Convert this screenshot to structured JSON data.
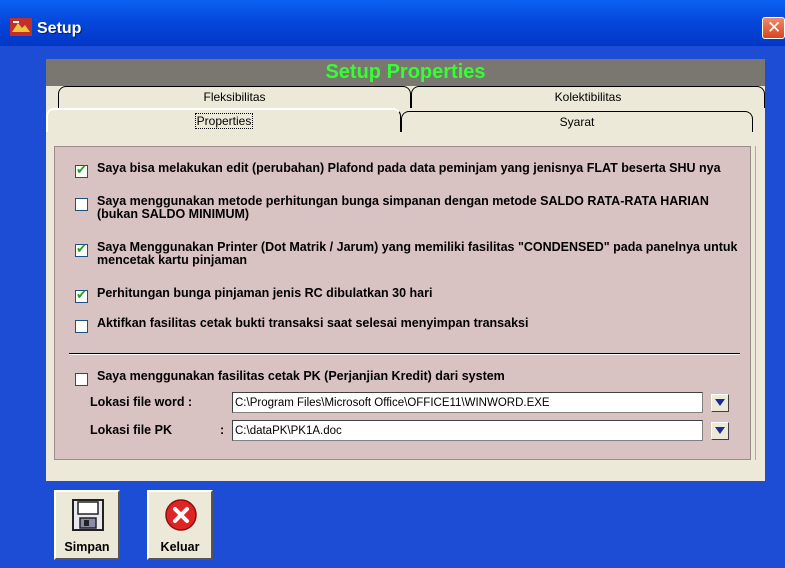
{
  "window": {
    "title": "Setup",
    "close_icon": "close-icon",
    "app_icon": "setup-app-icon"
  },
  "header": {
    "title": "Setup Properties"
  },
  "tabs": [
    {
      "label": "Fleksibilitas"
    },
    {
      "label": "Kolektibilitas"
    },
    {
      "label": "Properties",
      "active": true
    },
    {
      "label": "Syarat"
    }
  ],
  "options": [
    {
      "checked": true,
      "text": "Saya bisa melakukan edit (perubahan) Plafond pada data peminjam yang jenisnya FLAT beserta SHU nya"
    },
    {
      "checked": false,
      "text": "Saya menggunakan metode perhitungan bunga simpanan dengan metode SALDO RATA-RATA HARIAN (bukan SALDO MINIMUM)"
    },
    {
      "checked": true,
      "text": "Saya Menggunakan Printer (Dot Matrik / Jarum) yang memiliki fasilitas \"CONDENSED\" pada panelnya untuk mencetak kartu pinjaman"
    },
    {
      "checked": true,
      "text": "Perhitungan bunga pinjaman jenis RC dibulatkan 30 hari"
    },
    {
      "checked": false,
      "text": "Aktifkan fasilitas cetak bukti transaksi saat selesai menyimpan transaksi"
    },
    {
      "checked": false,
      "text": "Saya menggunakan  fasilitas cetak PK (Perjanjian Kredit) dari system"
    }
  ],
  "files": {
    "word_label": "Lokasi file word :",
    "word_value": "C:\\Program Files\\Microsoft Office\\OFFICE11\\WINWORD.EXE",
    "pk_label": "Lokasi file PK",
    "pk_colon": ":",
    "pk_value": "C:\\dataPK\\PK1A.doc"
  },
  "buttons": {
    "save_label": "Simpan",
    "exit_label": "Keluar"
  },
  "colors": {
    "titlebar": "#0548dc",
    "header_text": "#33ff33",
    "content_bg": "#d9c2c2",
    "check_mark": "#21a121"
  }
}
